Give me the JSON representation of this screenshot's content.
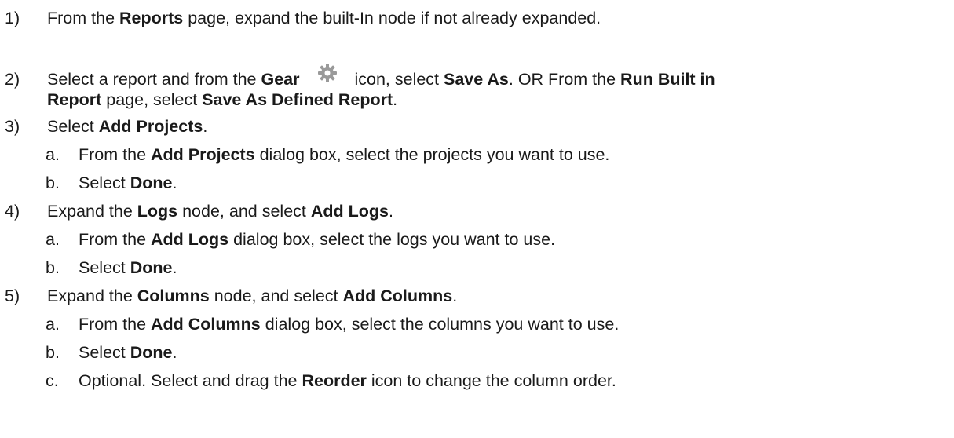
{
  "steps": [
    {
      "num": "1)",
      "parts": [
        "From the ",
        "Reports",
        " page, expand the built-In node if not already expanded."
      ]
    },
    {
      "num": "2)",
      "line1": [
        "Select a report and from the ",
        "Gear",
        " icon, select ",
        "Save As",
        ". OR From the ",
        "Run Built in"
      ],
      "line2": [
        "Report",
        " page, select ",
        "Save As Defined Report",
        "."
      ]
    },
    {
      "num": "3)",
      "parts": [
        "Select ",
        "Add Projects",
        "."
      ],
      "subs": [
        {
          "letter": "a.",
          "parts": [
            "From the ",
            "Add Projects",
            " dialog box, select the projects you want to use."
          ]
        },
        {
          "letter": "b.",
          "parts": [
            "Select ",
            "Done",
            "."
          ]
        }
      ]
    },
    {
      "num": "4)",
      "parts": [
        "Expand the ",
        "Logs",
        " node, and select ",
        "Add Logs",
        "."
      ],
      "subs": [
        {
          "letter": "a.",
          "parts": [
            "From the ",
            "Add Logs",
            " dialog box, select the logs you want to use."
          ]
        },
        {
          "letter": "b.",
          "parts": [
            "Select ",
            "Done",
            "."
          ]
        }
      ]
    },
    {
      "num": "5)",
      "parts": [
        "Expand the ",
        "Columns",
        " node, and select ",
        "Add Columns",
        "."
      ],
      "subs": [
        {
          "letter": "a.",
          "parts": [
            "From the ",
            "Add Columns",
            " dialog box, select the columns you want to use."
          ]
        },
        {
          "letter": "b.",
          "parts": [
            "Select ",
            "Done",
            "."
          ]
        },
        {
          "letter": "c.",
          "parts": [
            "Optional. Select and drag the ",
            "Reorder",
            " icon to change the column order."
          ]
        }
      ]
    }
  ],
  "icons": {
    "gear": "gear-icon"
  },
  "colors": {
    "text": "#1a1a1a",
    "gear": "#9a9a9a"
  }
}
